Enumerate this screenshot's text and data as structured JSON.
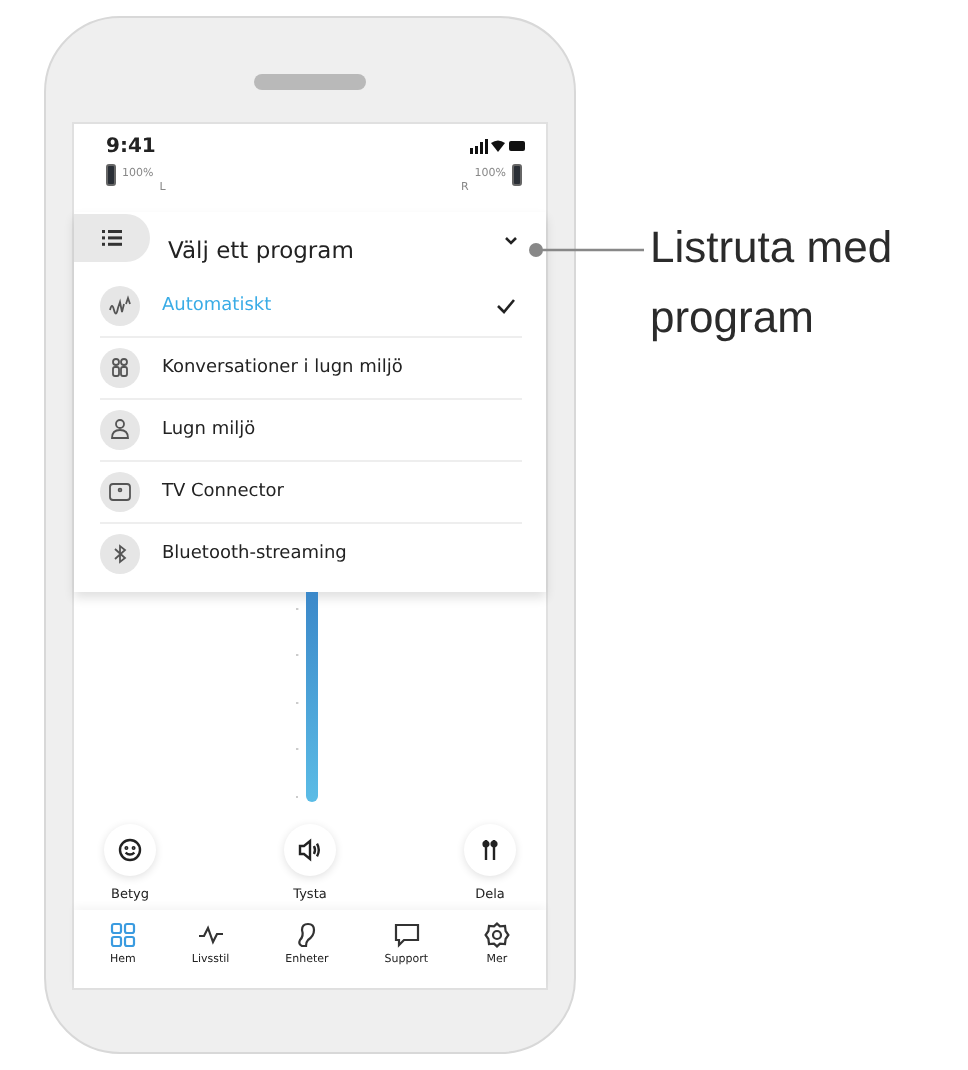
{
  "status_bar": {
    "time": "9:41"
  },
  "batteries": {
    "left": {
      "percent": "100%",
      "side": "L"
    },
    "right": {
      "side": "R",
      "percent": "100%"
    }
  },
  "program_menu": {
    "title": "Välj ett program",
    "items": [
      {
        "label": "Automatiskt",
        "kind": "automatic",
        "selected": true
      },
      {
        "label": "Konversationer i lugn miljö",
        "kind": "conversation",
        "selected": false
      },
      {
        "label": "Lugn miljö",
        "kind": "quiet",
        "selected": false
      },
      {
        "label": "TV Connector",
        "kind": "tv",
        "selected": false
      },
      {
        "label": "Bluetooth-streaming",
        "kind": "bluetooth",
        "selected": false
      }
    ]
  },
  "actions": [
    {
      "label": "Betyg",
      "kind": "rate"
    },
    {
      "label": "Tysta",
      "kind": "mute"
    },
    {
      "label": "Dela",
      "kind": "share"
    }
  ],
  "tab_bar": [
    {
      "label": "Hem",
      "kind": "home",
      "selected": true
    },
    {
      "label": "Livsstil",
      "kind": "lifestyle",
      "selected": false
    },
    {
      "label": "Enheter",
      "kind": "devices",
      "selected": false
    },
    {
      "label": "Support",
      "kind": "support",
      "selected": false
    },
    {
      "label": "Mer",
      "kind": "more",
      "selected": false
    }
  ],
  "callout": {
    "text": "Listruta med program"
  }
}
